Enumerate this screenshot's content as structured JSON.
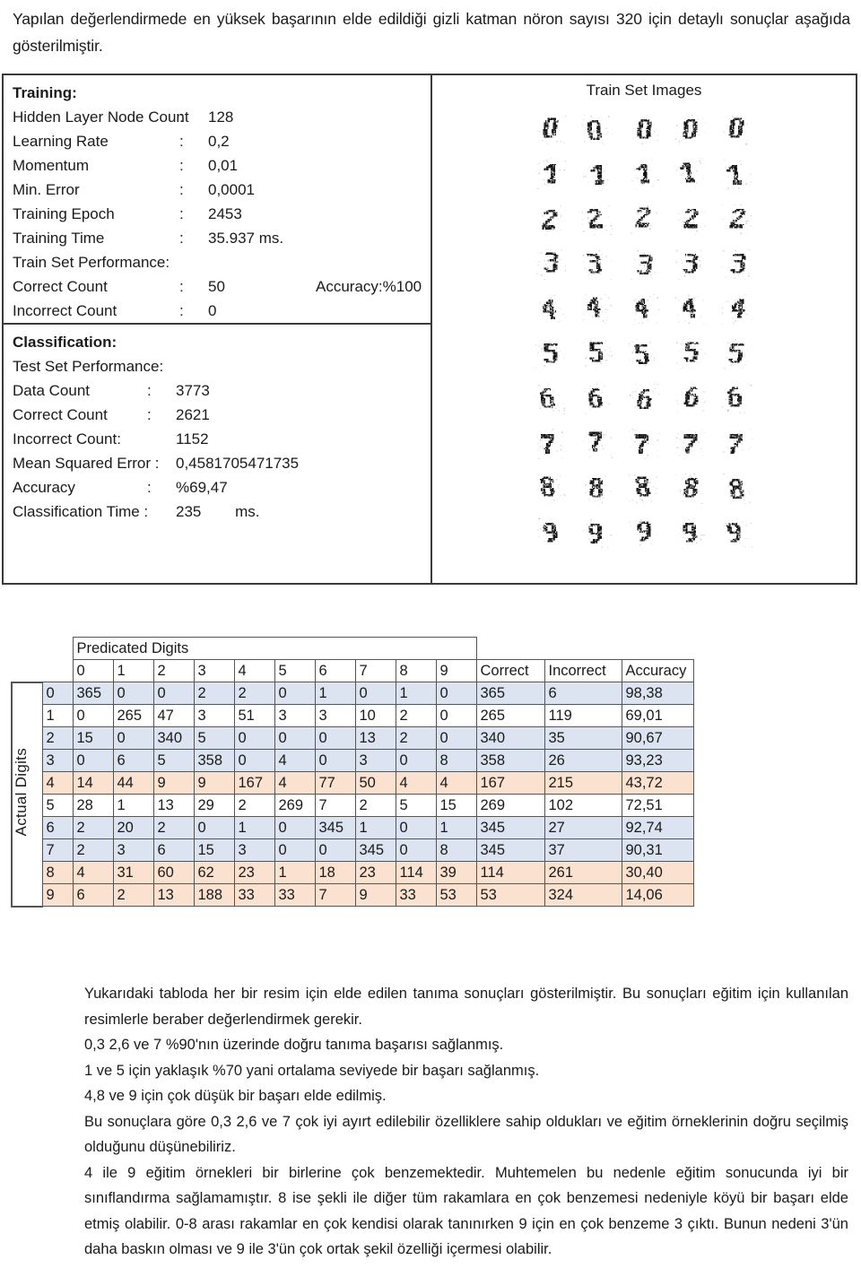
{
  "intro": {
    "text": "Yapılan değerlendirmede en yüksek başarının elde edildiği gizli katman nöron sayısı 320 için detaylı sonuçlar aşağıda gösterilmiştir."
  },
  "training": {
    "title": "Training:",
    "rows": [
      {
        "key": "Hidden Layer Node Count",
        "colon": ":",
        "value": "128"
      },
      {
        "key": "Learning Rate",
        "colon": ":",
        "value": "0,2"
      },
      {
        "key": "Momentum",
        "colon": ":",
        "value": "0,01"
      },
      {
        "key": "Min. Error",
        "colon": ":",
        "value": "0,0001"
      },
      {
        "key": "Training Epoch",
        "colon": ":",
        "value": "2453"
      },
      {
        "key": "Training Time",
        "colon": ":",
        "value": "35.937 ms."
      }
    ],
    "perf_title": "Train Set Performance:",
    "perf_rows": [
      {
        "key": "Correct Count",
        "colon": ":",
        "value": "50",
        "extra": "Accuracy:%100"
      },
      {
        "key": "Incorrect Count",
        "colon": ":",
        "value": "0",
        "extra": ""
      }
    ]
  },
  "classification": {
    "title": "Classification:",
    "perf_title": "Test Set Performance:",
    "rows": [
      {
        "key": "Data Count",
        "colon": ":",
        "value": "3773"
      },
      {
        "key": "Correct Count",
        "colon": ":",
        "value": "2621"
      },
      {
        "key": "Incorrect Count:",
        "colon": "",
        "value": "1152"
      },
      {
        "key": "Mean Squared Error :",
        "colon": "",
        "value": "0,4581705471735"
      },
      {
        "key": "Accuracy",
        "colon": ":",
        "value": "%69,47"
      },
      {
        "key": "Classification Time :",
        "colon": "",
        "value": "235        ms."
      }
    ]
  },
  "train_set_images": {
    "title": "Train Set Images",
    "digits": [
      0,
      1,
      2,
      3,
      4,
      5,
      6,
      7,
      8,
      9
    ],
    "samples_per_digit": 5
  },
  "matrix": {
    "predicted_header": "Predicated Digits",
    "actual_header": "Actual Digits",
    "col_headers": [
      "0",
      "1",
      "2",
      "3",
      "4",
      "5",
      "6",
      "7",
      "8",
      "9"
    ],
    "summary_headers": [
      "Correct",
      "Incorrect",
      "Accuracy"
    ],
    "colors": {
      "blue": "#dbe4f0",
      "orange": "#fbe2d0",
      "white": "#ffffff"
    },
    "rows": [
      {
        "actual": "0",
        "counts": [
          "365",
          "0",
          "0",
          "2",
          "2",
          "0",
          "1",
          "0",
          "1",
          "0"
        ],
        "correct": "365",
        "incorrect": "6",
        "accuracy": "98,38",
        "tone": "blue"
      },
      {
        "actual": "1",
        "counts": [
          "0",
          "265",
          "47",
          "3",
          "51",
          "3",
          "3",
          "10",
          "2",
          "0"
        ],
        "correct": "265",
        "incorrect": "119",
        "accuracy": "69,01",
        "tone": "white"
      },
      {
        "actual": "2",
        "counts": [
          "15",
          "0",
          "340",
          "5",
          "0",
          "0",
          "0",
          "13",
          "2",
          "0"
        ],
        "correct": "340",
        "incorrect": "35",
        "accuracy": "90,67",
        "tone": "blue"
      },
      {
        "actual": "3",
        "counts": [
          "0",
          "6",
          "5",
          "358",
          "0",
          "4",
          "0",
          "3",
          "0",
          "8"
        ],
        "correct": "358",
        "incorrect": "26",
        "accuracy": "93,23",
        "tone": "blue"
      },
      {
        "actual": "4",
        "counts": [
          "14",
          "44",
          "9",
          "9",
          "167",
          "4",
          "77",
          "50",
          "4",
          "4"
        ],
        "correct": "167",
        "incorrect": "215",
        "accuracy": "43,72",
        "tone": "orange"
      },
      {
        "actual": "5",
        "counts": [
          "28",
          "1",
          "13",
          "29",
          "2",
          "269",
          "7",
          "2",
          "5",
          "15"
        ],
        "correct": "269",
        "incorrect": "102",
        "accuracy": "72,51",
        "tone": "white"
      },
      {
        "actual": "6",
        "counts": [
          "2",
          "20",
          "2",
          "0",
          "1",
          "0",
          "345",
          "1",
          "0",
          "1"
        ],
        "correct": "345",
        "incorrect": "27",
        "accuracy": "92,74",
        "tone": "blue"
      },
      {
        "actual": "7",
        "counts": [
          "2",
          "3",
          "6",
          "15",
          "3",
          "0",
          "0",
          "345",
          "0",
          "8"
        ],
        "correct": "345",
        "incorrect": "37",
        "accuracy": "90,31",
        "tone": "blue"
      },
      {
        "actual": "8",
        "counts": [
          "4",
          "31",
          "60",
          "62",
          "23",
          "1",
          "18",
          "23",
          "114",
          "39"
        ],
        "correct": "114",
        "incorrect": "261",
        "accuracy": "30,40",
        "tone": "orange"
      },
      {
        "actual": "9",
        "counts": [
          "6",
          "2",
          "13",
          "188",
          "33",
          "33",
          "7",
          "9",
          "33",
          "53"
        ],
        "correct": "53",
        "incorrect": "324",
        "accuracy": "14,06",
        "tone": "orange"
      }
    ]
  },
  "notes": {
    "p1": "Yukarıdaki tabloda her bir resim için elde edilen tanıma sonuçları gösterilmiştir. Bu sonuçları eğitim için kullanılan resimlerle beraber değerlendirmek gerekir.",
    "p2": "0,3 2,6 ve 7 %90'nın üzerinde doğru tanıma başarısı sağlanmış.",
    "p3": "1 ve 5  için yaklaşık %70 yani ortalama seviyede bir başarı sağlanmış.",
    "p4": "4,8 ve 9 için çok düşük bir başarı elde edilmiş.",
    "p5": "Bu sonuçlara göre 0,3 2,6 ve 7 çok iyi ayırt edilebilir özelliklere sahip oldukları ve eğitim örneklerinin doğru seçilmiş olduğunu düşünebiliriz.",
    "p6": "4 ile 9 eğitim örnekleri bir birlerine çok benzemektedir. Muhtemelen bu nedenle eğitim sonucunda iyi bir sınıflandırma sağlamamıştır. 8 ise şekli ile diğer tüm rakamlara en çok benzemesi nedeniyle köyü bir başarı elde etmiş olabilir. 0-8 arası rakamlar en çok kendisi olarak tanınırken 9 için en çok benzeme 3 çıktı. Bunun nedeni 3'ün daha baskın olması ve 9 ile 3'ün çok ortak şekil özelliği içermesi olabilir."
  }
}
